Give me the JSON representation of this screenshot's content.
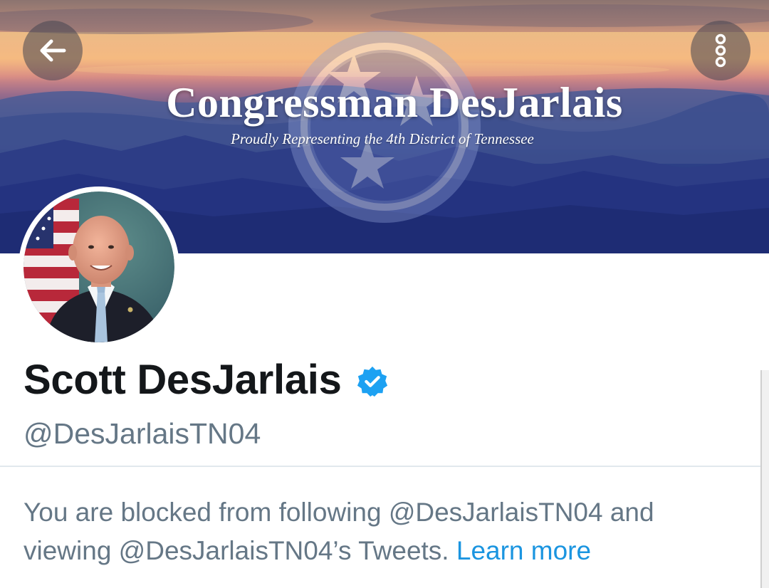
{
  "banner": {
    "title": "Congressman DesJarlais",
    "subtitle": "Proudly Representing the 4th District of Tennessee",
    "emblem_icon": "tennessee-tri-star-icon"
  },
  "nav": {
    "back_icon": "arrow-left-icon",
    "more_icon": "more-vertical-icon"
  },
  "profile": {
    "display_name": "Scott DesJarlais",
    "verified_icon": "verified-badge-icon",
    "handle": "@DesJarlaisTN04"
  },
  "blocked_notice": {
    "message": "You are blocked from following @DesJarlaisTN04 and viewing @DesJarlaisTN04’s Tweets.",
    "link_label": "Learn more"
  },
  "colors": {
    "name": "#14171a",
    "secondary_text": "#657786",
    "link": "#1b95e0",
    "verified": "#1da1f2",
    "divider": "#e1e8ed"
  }
}
